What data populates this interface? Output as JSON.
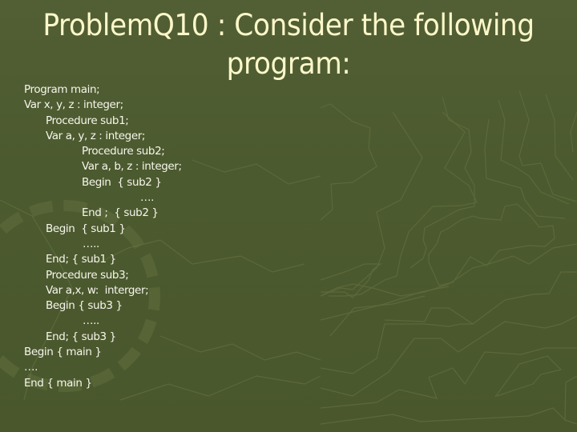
{
  "slide": {
    "title": "ProblemQ10 : Consider the following program:",
    "colors": {
      "background": "#4c5a2f",
      "title_text": "#fbf7c9",
      "body_text": "#f6f6ec",
      "texture_lines": "#5d6a3c"
    },
    "code_lines": [
      "Program main;",
      "Var x, y, z : integer;",
      "Procedure sub1;",
      "Var a, y, z : integer;",
      "Procedure sub2;",
      "Var a, b, z : integer;",
      "Begin  { sub2 }",
      "….",
      "End ;  { sub2 }",
      "Begin  { sub1 }",
      "…..",
      "End; { sub1 }",
      "Procedure sub3;",
      "Var a,x, w:  interger;",
      "Begin { sub3 }",
      "…..",
      "End; { sub3 }",
      "Begin { main }",
      "….",
      "End { main }"
    ]
  }
}
